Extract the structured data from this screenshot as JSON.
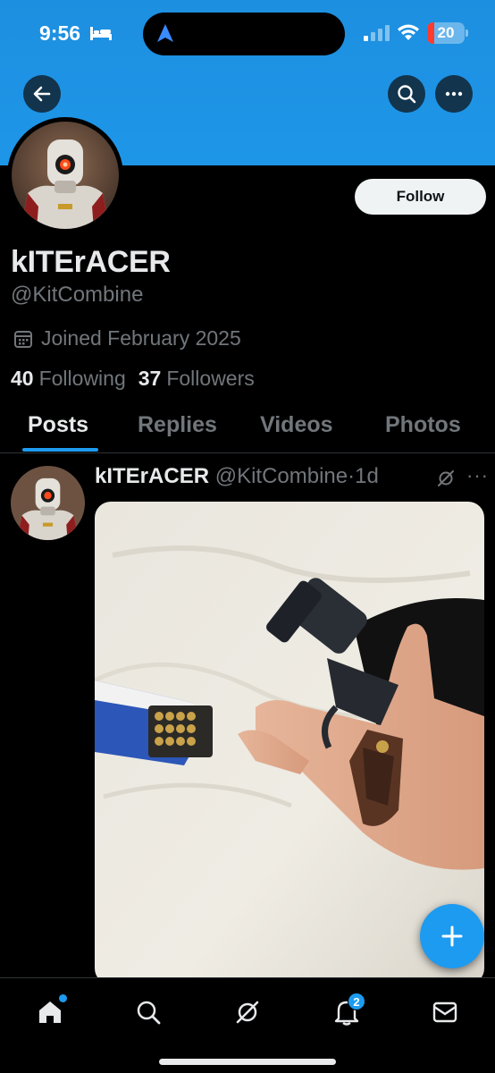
{
  "status_bar": {
    "time": "9:56",
    "battery_level": "20",
    "battery_fraction": 0.2
  },
  "profile": {
    "display_name": "kITErACER",
    "handle": "@KitCombine",
    "joined": "Joined February 2025",
    "following_count": "40",
    "following_label": "Following",
    "followers_count": "37",
    "followers_label": "Followers",
    "follow_button": "Follow",
    "banner_color": "#1d8fe0"
  },
  "tabs": [
    {
      "label": "Posts",
      "active": true
    },
    {
      "label": "Replies",
      "active": false
    },
    {
      "label": "Videos",
      "active": false
    },
    {
      "label": "Photos",
      "active": false
    }
  ],
  "post": {
    "author_name": "kITErACER",
    "author_handle": "@KitCombine",
    "separator": "·",
    "time_ago": "1d",
    "more": "···",
    "media_description_icon": "photo"
  },
  "bottom_nav": {
    "items": [
      "home-icon",
      "search-icon",
      "grok-icon",
      "notifications-icon",
      "messages-icon"
    ],
    "notification_count": "2"
  },
  "colors": {
    "accent": "#1d9bf0",
    "background": "#000000",
    "secondary_text": "#71767b"
  }
}
